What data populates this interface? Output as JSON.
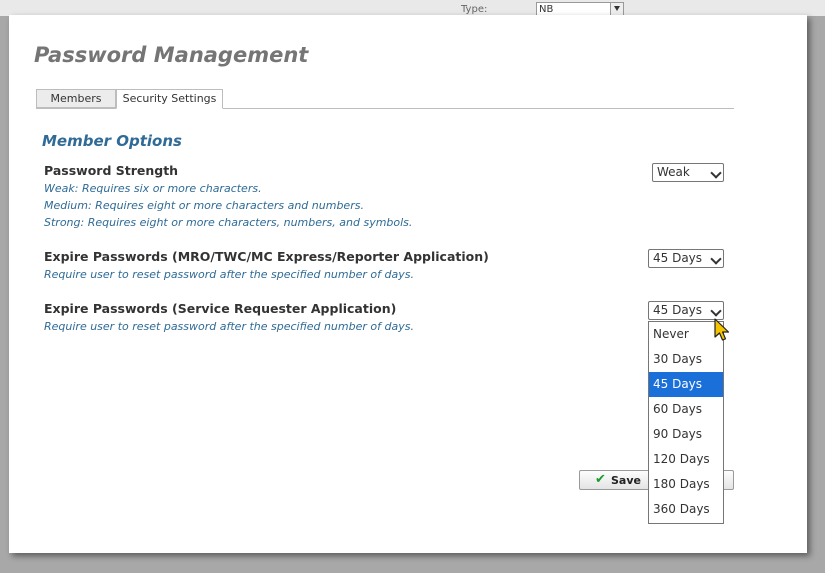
{
  "background": {
    "type_label": "Type:",
    "type_value": "NB"
  },
  "dialog": {
    "title": "Password Management",
    "tabs": [
      {
        "label": "Members",
        "active": false
      },
      {
        "label": "Security Settings",
        "active": true
      }
    ],
    "section_title": "Member Options",
    "options": [
      {
        "title": "Password Strength",
        "descriptions": [
          "Weak: Requires six or more characters.",
          "Medium: Requires eight or more characters and numbers.",
          "Strong: Requires eight or more characters, numbers, and symbols."
        ],
        "selected": "Weak"
      },
      {
        "title": "Expire Passwords (MRO/TWC/MC Express/Reporter Application)",
        "descriptions": [
          "Require user to reset password after the specified number of days."
        ],
        "selected": "45 Days"
      },
      {
        "title": "Expire Passwords (Service Requester Application)",
        "descriptions": [
          "Require user to reset password after the specified number of days."
        ],
        "selected": "45 Days"
      }
    ],
    "dropdown_options": [
      "Never",
      "30 Days",
      "45 Days",
      "60 Days",
      "90 Days",
      "120 Days",
      "180 Days",
      "360 Days"
    ],
    "dropdown_highlighted": "45 Days",
    "save_label": "Save"
  },
  "colors": {
    "section_blue": "#2f6b96",
    "highlight_blue": "#1a6fd9",
    "check_green": "#1a9a2c"
  }
}
